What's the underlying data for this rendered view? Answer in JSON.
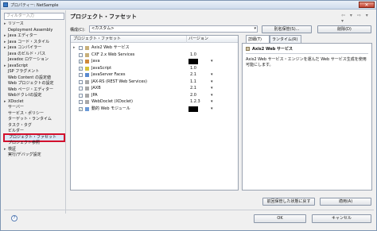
{
  "window": {
    "title": "プロパティー: NetSample",
    "close_glyph": "✕"
  },
  "filter": {
    "placeholder": "フィルター入力"
  },
  "tree": {
    "items": [
      {
        "label": "リソース",
        "expander": "▸"
      },
      {
        "label": "Deployment Assembly",
        "expander": ""
      },
      {
        "label": "Java エディター",
        "expander": "▸"
      },
      {
        "label": "Java コード・スタイル",
        "expander": "▸"
      },
      {
        "label": "Java コンパイラー",
        "expander": "▸"
      },
      {
        "label": "Java のビルド・パス",
        "expander": ""
      },
      {
        "label": "Javadoc ロケーション",
        "expander": ""
      },
      {
        "label": "JavaScript",
        "expander": "▸"
      },
      {
        "label": "JSP フラグメント",
        "expander": ""
      },
      {
        "label": "Web Content の設定値",
        "expander": ""
      },
      {
        "label": "Web プロジェクトの設定",
        "expander": ""
      },
      {
        "label": "Web ページ・エディター",
        "expander": ""
      },
      {
        "label": "WebドクレIの設定",
        "expander": ""
      },
      {
        "label": "XDoclet",
        "expander": "▸"
      },
      {
        "label": "サーバー",
        "expander": ""
      },
      {
        "label": "サービス・ポリシー",
        "expander": ""
      },
      {
        "label": "ターゲット・ランタイム",
        "expander": ""
      },
      {
        "label": "タスク・タグ",
        "expander": ""
      },
      {
        "label": "ビルダー",
        "expander": ""
      },
      {
        "label": "プロジェクト・ファセット",
        "expander": ""
      },
      {
        "label": "プロジェクト参照",
        "expander": ""
      },
      {
        "label": "検証",
        "expander": "▸"
      },
      {
        "label": "実行/デバッグ設定",
        "expander": ""
      }
    ],
    "selected_index": 19
  },
  "page": {
    "title": "プロジェクト・ファセット",
    "nav_arrows": "⇦ ▾ ⇨ ▾ ▾"
  },
  "config": {
    "label": "構成(C):",
    "value": "<カスタム>",
    "arrow": "▾",
    "save_as_label": "別名保管(S)...",
    "delete_label": "削除(D)"
  },
  "facets": {
    "col_facet": "プロジェクト・ファセット",
    "col_version": "バージョン",
    "rows": [
      {
        "expander": "▸",
        "checked": false,
        "name": "Axis2 Web サービス",
        "version": "",
        "redacted": false,
        "dropdown": "",
        "icon_color": "#c8b07a",
        "indent": 0
      },
      {
        "expander": "",
        "checked": false,
        "name": "CXF 2.x Web Services",
        "version": "1.0",
        "redacted": false,
        "dropdown": "",
        "icon_color": "#c8b07a",
        "indent": 0
      },
      {
        "expander": "",
        "checked": true,
        "name": "Java",
        "version": "",
        "redacted": true,
        "dropdown": "▾",
        "icon_color": "#d08a3a",
        "indent": 0
      },
      {
        "expander": "",
        "checked": true,
        "name": "JavaScript",
        "version": "1.0",
        "redacted": false,
        "dropdown": "",
        "icon_color": "#d6c23a",
        "indent": 0
      },
      {
        "expander": "",
        "checked": false,
        "name": "JavaServer Faces",
        "version": "2.1",
        "redacted": false,
        "dropdown": "▾",
        "icon_color": "#5a8ad0",
        "indent": 0
      },
      {
        "expander": "",
        "checked": false,
        "name": "JAX-RS (REST Web Services)",
        "version": "1.1",
        "redacted": false,
        "dropdown": "▾",
        "icon_color": "#a8a8a8",
        "indent": 0
      },
      {
        "expander": "",
        "checked": false,
        "name": "JAXB",
        "version": "2.1",
        "redacted": false,
        "dropdown": "▾",
        "icon_color": "#a8a8a8",
        "indent": 0
      },
      {
        "expander": "",
        "checked": false,
        "name": "JPA",
        "version": "2.0",
        "redacted": false,
        "dropdown": "▾",
        "icon_color": "#a8a8a8",
        "indent": 0
      },
      {
        "expander": "",
        "checked": false,
        "name": "WebDoclet (XDoclet)",
        "version": "1.2.3",
        "redacted": false,
        "dropdown": "▾",
        "icon_color": "#a8a8a8",
        "indent": 0
      },
      {
        "expander": "",
        "checked": true,
        "name": "動的 Web モジュール",
        "version": "",
        "redacted": true,
        "dropdown": "▾",
        "icon_color": "#6a9ad8",
        "indent": 0
      }
    ]
  },
  "detail": {
    "tab_details": "詳細(T)",
    "tab_runtimes": "ランタイム(R)",
    "heading": "Axis2 Web サービス",
    "description": "Axis2 Web サービス・エンジンを運んだ Web サービス生成を使用可能にします。"
  },
  "footer": {
    "restore_label": "前回保管した状態に戻す",
    "apply_label": "適用(A)",
    "ok_label": "OK",
    "cancel_label": "キャンセル",
    "help_glyph": "?"
  }
}
